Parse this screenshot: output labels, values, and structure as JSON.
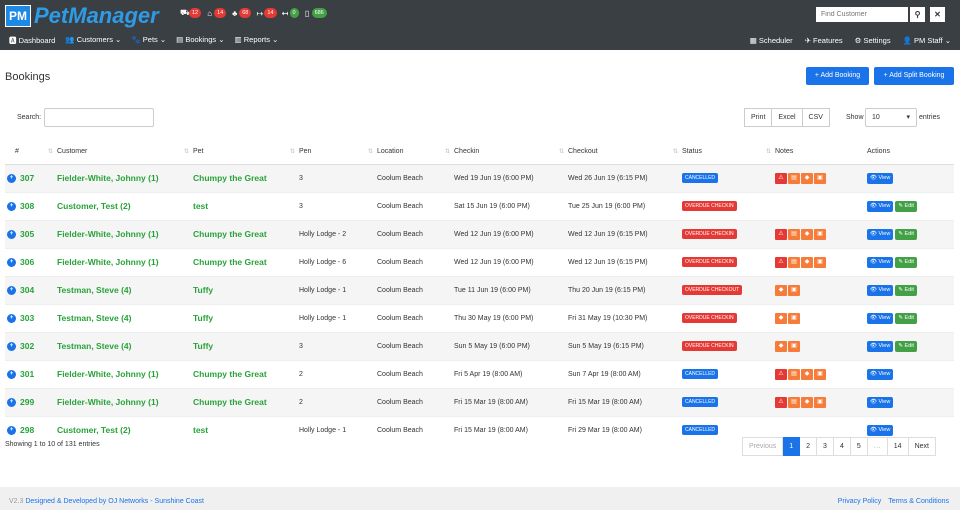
{
  "brand": {
    "pm": "PM",
    "pet": "Pet",
    "manager": "Manager"
  },
  "counters": [
    {
      "icon": "car-icon",
      "ico": "⛟",
      "count": "12",
      "color": "red"
    },
    {
      "icon": "home-icon",
      "ico": "⌂",
      "count": "14",
      "color": "red"
    },
    {
      "icon": "bell-icon",
      "ico": "♣",
      "count": "68",
      "color": "red"
    },
    {
      "icon": "dropoff-icon",
      "ico": "↦",
      "count": "14",
      "color": "red"
    },
    {
      "icon": "pickup-icon",
      "ico": "↤",
      "count": "0",
      "color": "green"
    },
    {
      "icon": "phone-icon",
      "ico": "▯",
      "count": "686",
      "color": "green"
    }
  ],
  "search_customer": {
    "placeholder": "Find Customer",
    "search_icon": "search-icon",
    "close_icon": "close-icon"
  },
  "nav_left": [
    {
      "name": "nav-dashboard",
      "label": "🅰 Dashboard"
    },
    {
      "name": "nav-customers",
      "label": "👥 Customers ⌄"
    },
    {
      "name": "nav-pets",
      "label": "🐾 Pets ⌄"
    },
    {
      "name": "nav-bookings",
      "label": "▤ Bookings ⌄"
    },
    {
      "name": "nav-reports",
      "label": "▥ Reports ⌄"
    }
  ],
  "nav_right": [
    {
      "name": "nav-scheduler",
      "label": "▦ Scheduler"
    },
    {
      "name": "nav-features",
      "label": "✈ Features"
    },
    {
      "name": "nav-settings",
      "label": "⚙ Settings"
    },
    {
      "name": "nav-user",
      "label": "👤 PM Staff ⌄"
    }
  ],
  "page": {
    "title": "Bookings",
    "add_booking": "+ Add Booking",
    "add_split": "+ Add Split Booking"
  },
  "controls": {
    "search_label": "Search:",
    "print": "Print",
    "excel": "Excel",
    "csv": "CSV",
    "show": "Show",
    "show_value": "10",
    "entries": "entries"
  },
  "columns": [
    "#",
    "Customer",
    "Pet",
    "Pen",
    "Location",
    "Checkin",
    "Checkout",
    "Status",
    "Notes",
    "Actions"
  ],
  "rows": [
    {
      "id": "307",
      "customer": "Fielder-White, Johnny (1)",
      "pet": "Chumpy the Great",
      "pen": "3",
      "location": "Coolum Beach",
      "checkin": "Wed 19 Jun 19 (6:00 PM)",
      "checkout": "Wed 26 Jun 19 (6:15 PM)",
      "status": "CANCELLED",
      "status_type": "cancel",
      "notes": [
        "warning",
        "note",
        "pet",
        "food"
      ],
      "edit": false
    },
    {
      "id": "308",
      "customer": "Customer, Test (2)",
      "pet": "test",
      "pen": "3",
      "location": "Coolum Beach",
      "checkin": "Sat 15 Jun 19 (6:00 PM)",
      "checkout": "Tue 25 Jun 19 (6:00 PM)",
      "status": "OVERDUE CHECKIN",
      "status_type": "over",
      "notes": [],
      "edit": true
    },
    {
      "id": "305",
      "customer": "Fielder-White, Johnny (1)",
      "pet": "Chumpy the Great",
      "pen": "Holly Lodge - 2",
      "location": "Coolum Beach",
      "checkin": "Wed 12 Jun 19 (6:00 PM)",
      "checkout": "Wed 12 Jun 19 (6:15 PM)",
      "status": "OVERDUE CHECKIN",
      "status_type": "over",
      "notes": [
        "warning",
        "note",
        "pet",
        "food"
      ],
      "edit": true
    },
    {
      "id": "306",
      "customer": "Fielder-White, Johnny (1)",
      "pet": "Chumpy the Great",
      "pen": "Holly Lodge - 6",
      "location": "Coolum Beach",
      "checkin": "Wed 12 Jun 19 (6:00 PM)",
      "checkout": "Wed 12 Jun 19 (6:15 PM)",
      "status": "OVERDUE CHECKIN",
      "status_type": "over",
      "notes": [
        "warning",
        "note",
        "pet",
        "food"
      ],
      "edit": true
    },
    {
      "id": "304",
      "customer": "Testman, Steve (4)",
      "pet": "Tuffy",
      "pen": "Holly Lodge - 1",
      "location": "Coolum Beach",
      "checkin": "Tue 11 Jun 19 (6:00 PM)",
      "checkout": "Thu 20 Jun 19 (6:15 PM)",
      "status": "OVERDUE CHECKOUT",
      "status_type": "over",
      "notes": [
        "pet",
        "food"
      ],
      "edit": true
    },
    {
      "id": "303",
      "customer": "Testman, Steve (4)",
      "pet": "Tuffy",
      "pen": "Holly Lodge - 1",
      "location": "Coolum Beach",
      "checkin": "Thu 30 May 19 (6:00 PM)",
      "checkout": "Fri 31 May 19 (10:30 PM)",
      "status": "OVERDUE CHECKIN",
      "status_type": "over",
      "notes": [
        "pet",
        "food"
      ],
      "edit": true
    },
    {
      "id": "302",
      "customer": "Testman, Steve (4)",
      "pet": "Tuffy",
      "pen": "3",
      "location": "Coolum Beach",
      "checkin": "Sun 5 May 19 (6:00 PM)",
      "checkout": "Sun 5 May 19 (6:15 PM)",
      "status": "OVERDUE CHECKIN",
      "status_type": "over",
      "notes": [
        "pet",
        "food"
      ],
      "edit": true
    },
    {
      "id": "301",
      "customer": "Fielder-White, Johnny (1)",
      "pet": "Chumpy the Great",
      "pen": "2",
      "location": "Coolum Beach",
      "checkin": "Fri 5 Apr 19 (8:00 AM)",
      "checkout": "Sun 7 Apr 19 (8:00 AM)",
      "status": "CANCELLED",
      "status_type": "cancel",
      "notes": [
        "warning",
        "note",
        "pet",
        "food"
      ],
      "edit": false
    },
    {
      "id": "299",
      "customer": "Fielder-White, Johnny (1)",
      "pet": "Chumpy the Great",
      "pen": "2",
      "location": "Coolum Beach",
      "checkin": "Fri 15 Mar 19 (8:00 AM)",
      "checkout": "Fri 15 Mar 19 (8:00 AM)",
      "status": "CANCELLED",
      "status_type": "cancel",
      "notes": [
        "warning",
        "note",
        "pet",
        "food"
      ],
      "edit": false
    },
    {
      "id": "298",
      "customer": "Customer, Test (2)",
      "pet": "test",
      "pen": "Holly Lodge - 1",
      "location": "Coolum Beach",
      "checkin": "Fri 15 Mar 19 (8:00 AM)",
      "checkout": "Fri 29 Mar 19 (8:00 AM)",
      "status": "CANCELLED",
      "status_type": "cancel",
      "notes": [],
      "edit": false
    }
  ],
  "actions": {
    "view": "👁 View",
    "edit": "✎ Edit"
  },
  "info": "Showing 1 to 10 of 131 entries",
  "pagination": [
    "Previous",
    "1",
    "2",
    "3",
    "4",
    "5",
    "…",
    "14",
    "Next"
  ],
  "footer": {
    "version": "V2.3",
    "dev": "Designed & Developed by OJ Networks - Sunshine Coast",
    "privacy": "Privacy Policy",
    "terms": "Terms & Conditions"
  }
}
